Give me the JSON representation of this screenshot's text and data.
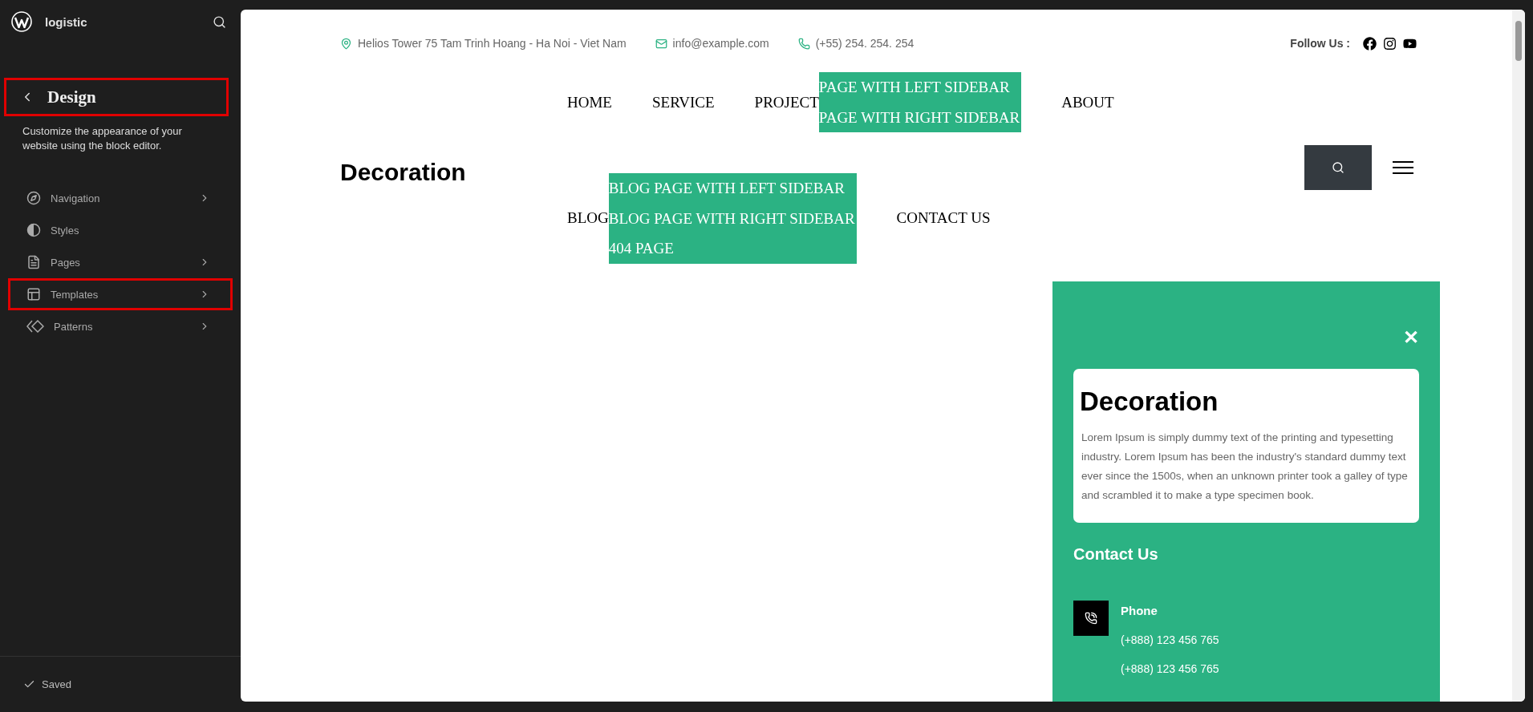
{
  "sidebar": {
    "site_name": "logistic",
    "header": {
      "title": "Design",
      "highlighted": true
    },
    "description": "Customize the appearance of your website using the block editor.",
    "items": [
      {
        "kind": "compass",
        "label": "Navigation",
        "has_chevron": true,
        "highlighted": false
      },
      {
        "kind": "contrast",
        "label": "Styles",
        "has_chevron": false,
        "highlighted": false
      },
      {
        "kind": "document",
        "label": "Pages",
        "has_chevron": true,
        "highlighted": false
      },
      {
        "kind": "layout",
        "label": "Templates",
        "has_chevron": true,
        "highlighted": true
      },
      {
        "kind": "diamonds",
        "label": "Patterns",
        "has_chevron": true,
        "highlighted": false
      }
    ],
    "status": "Saved"
  },
  "page": {
    "top_bar": {
      "contacts": [
        {
          "kind": "location",
          "text": "Helios Tower 75 Tam Trinh Hoang - Ha Noi - Viet Nam"
        },
        {
          "kind": "email",
          "text": "info@example.com"
        },
        {
          "kind": "phone",
          "text": "(+55) 254. 254. 254"
        }
      ],
      "follow_label": "Follow Us :",
      "socials": [
        {
          "kind": "facebook"
        },
        {
          "kind": "instagram"
        },
        {
          "kind": "youtube"
        }
      ]
    },
    "logo": "Decoration",
    "menu_rows": [
      [
        {
          "label": "HOME"
        },
        {
          "label": "SERVICE"
        },
        {
          "label": "PROJECT",
          "submenu": [
            "PAGE WITH LEFT SIDEBAR",
            "PAGE WITH RIGHT SIDEBAR"
          ]
        },
        {
          "label": "ABOUT"
        }
      ],
      [
        {
          "label": "BLOG",
          "submenu": [
            "BLOG PAGE WITH LEFT SIDEBAR",
            "BLOG PAGE WITH RIGHT SIDEBAR",
            "404 PAGE"
          ]
        },
        {
          "label": "CONTACT US"
        }
      ]
    ],
    "offcanvas": {
      "close": "✕",
      "card": {
        "title": "Decoration",
        "text": "Lorem Ipsum is simply dummy text of the printing and typesetting industry. Lorem Ipsum has been the industry's standard dummy text ever since the 1500s, when an unknown printer took a galley of type and scrambled it to make a type specimen book."
      },
      "contact_title": "Contact Us",
      "contacts": [
        {
          "kind": "phone",
          "label": "Phone",
          "lines": [
            "(+888) 123 456 765",
            "(+888) 123 456 765"
          ]
        }
      ]
    }
  }
}
